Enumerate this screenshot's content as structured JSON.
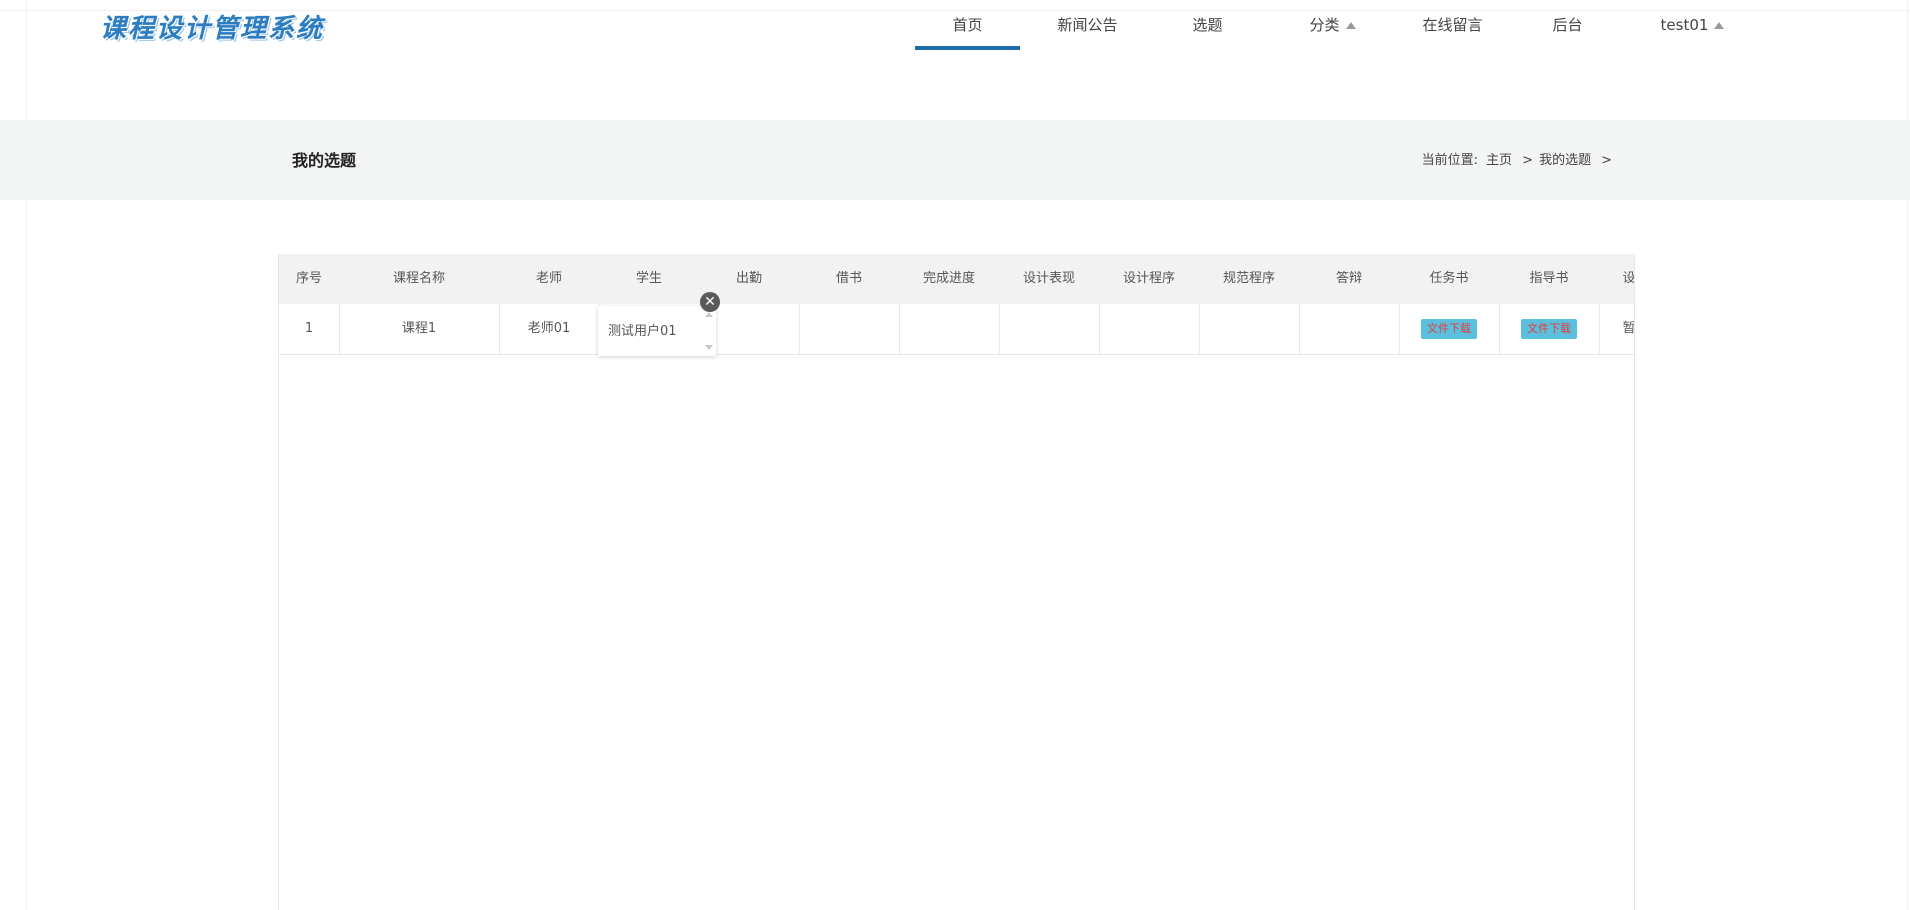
{
  "brand": {
    "logo_text": "课程设计管理系统"
  },
  "nav": {
    "items": [
      {
        "label": "首页",
        "active": true
      },
      {
        "label": "新闻公告"
      },
      {
        "label": "选题"
      },
      {
        "label": "分类",
        "dropdown": true
      },
      {
        "label": "在线留言"
      },
      {
        "label": "后台"
      },
      {
        "label": "test01",
        "dropdown": true
      }
    ]
  },
  "page": {
    "title": "我的选题",
    "breadcrumb": {
      "prefix": "当前位置:",
      "home": "主页",
      "current": "我的选题",
      "sep": ">"
    }
  },
  "table": {
    "columns": [
      "序号",
      "课程名称",
      "老师",
      "学生",
      "出勤",
      "借书",
      "完成进度",
      "设计表现",
      "设计程序",
      "规范程序",
      "答辩",
      "任务书",
      "指导书",
      "设"
    ],
    "rows": [
      {
        "index": "1",
        "course": "课程1",
        "teacher": "老师01",
        "student": "测试用户01",
        "attendance": "",
        "borrow": "",
        "progress": "",
        "design_perf": "",
        "design_prog": "",
        "standard_prog": "",
        "defense": "",
        "task_book": "文件下载",
        "guide_book": "文件下载",
        "last": "暂"
      }
    ]
  },
  "colors": {
    "accent": "#1e6aab",
    "band": "#f3f4f4",
    "download_bg": "#5bc0de",
    "download_text": "#e23b3b"
  }
}
